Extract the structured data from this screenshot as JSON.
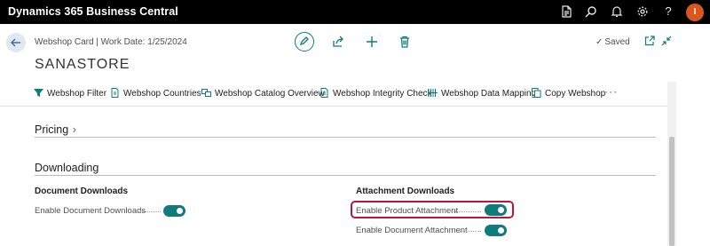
{
  "app": {
    "title": "Dynamics 365 Business Central",
    "avatar_initial": "I",
    "avatar_color": "#d9571e",
    "topbar_icons": [
      "document-icon",
      "search-icon",
      "bell-icon",
      "gear-icon",
      "help-icon"
    ]
  },
  "header": {
    "breadcrumb": "Webshop Card | Work Date: 1/25/2024",
    "title": "SANASTORE",
    "saved_label": "Saved",
    "accent_color": "#0f7b7b"
  },
  "actions": [
    {
      "label": "Webshop Filter",
      "icon": "filter-icon"
    },
    {
      "label": "Webshop Countries",
      "icon": "document-icon"
    },
    {
      "label": "Webshop Catalog Overview",
      "icon": "catalog-icon"
    },
    {
      "label": "Webshop Integrity Check",
      "icon": "document-icon"
    },
    {
      "label": "Webshop Data Mapping",
      "icon": "mapping-icon"
    },
    {
      "label": "Copy Webshop",
      "icon": "copy-icon"
    }
  ],
  "more_label": "···",
  "sections": {
    "pricing": {
      "title": "Pricing",
      "chevron": "›"
    },
    "downloading": {
      "title": "Downloading",
      "document_downloads": {
        "heading": "Document Downloads",
        "fields": [
          {
            "label": "Enable Document Downloads",
            "value": true
          }
        ]
      },
      "attachment_downloads": {
        "heading": "Attachment Downloads",
        "fields": [
          {
            "label": "Enable Product Attachment",
            "value": true
          },
          {
            "label": "Enable Document Attachment",
            "value": true
          }
        ]
      }
    }
  }
}
